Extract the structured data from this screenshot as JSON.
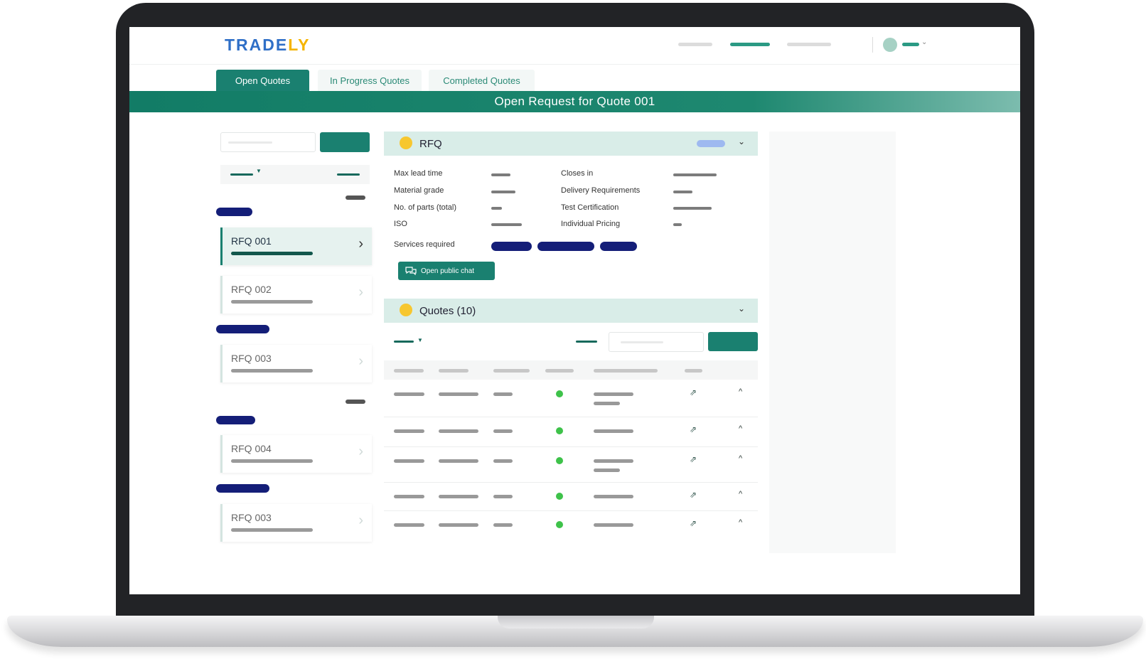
{
  "app": {
    "logo_part1": "TRADE",
    "logo_part2": "LY",
    "colors": {
      "primary": "#1a8070",
      "navy": "#141e78",
      "accent_yellow": "#f7c72f",
      "status_green": "#3ec24a"
    }
  },
  "tabs": [
    {
      "label": "Open Quotes",
      "active": true
    },
    {
      "label": "In Progress Quotes",
      "active": false
    },
    {
      "label": "Completed Quotes",
      "active": false
    }
  ],
  "banner": {
    "title": "Open Request for Quote 001"
  },
  "rfq_list": [
    {
      "label": "RFQ 001",
      "active": true
    },
    {
      "label": "RFQ 002",
      "active": false
    },
    {
      "label": "RFQ 003",
      "active": false
    },
    {
      "label": "RFQ 004",
      "active": false
    },
    {
      "label": "RFQ 003",
      "active": false
    }
  ],
  "rfq_panel": {
    "title": "RFQ",
    "fields_left": [
      "Max lead time",
      "Material grade",
      "No. of parts (total)",
      "ISO"
    ],
    "fields_right": [
      "Closes in",
      "Delivery Requirements",
      "Test Certification",
      "Individual Pricing"
    ],
    "services_label": "Services required",
    "chat_button": "Open public chat"
  },
  "quotes_panel": {
    "title": "Quotes (10)",
    "row_count": 5
  },
  "icons": {
    "chevron": "chevron-right-icon",
    "collapse": "chevron-down-icon",
    "chat": "chat-icon",
    "external": "external-link-icon",
    "expand_up": "chevron-up-icon"
  }
}
